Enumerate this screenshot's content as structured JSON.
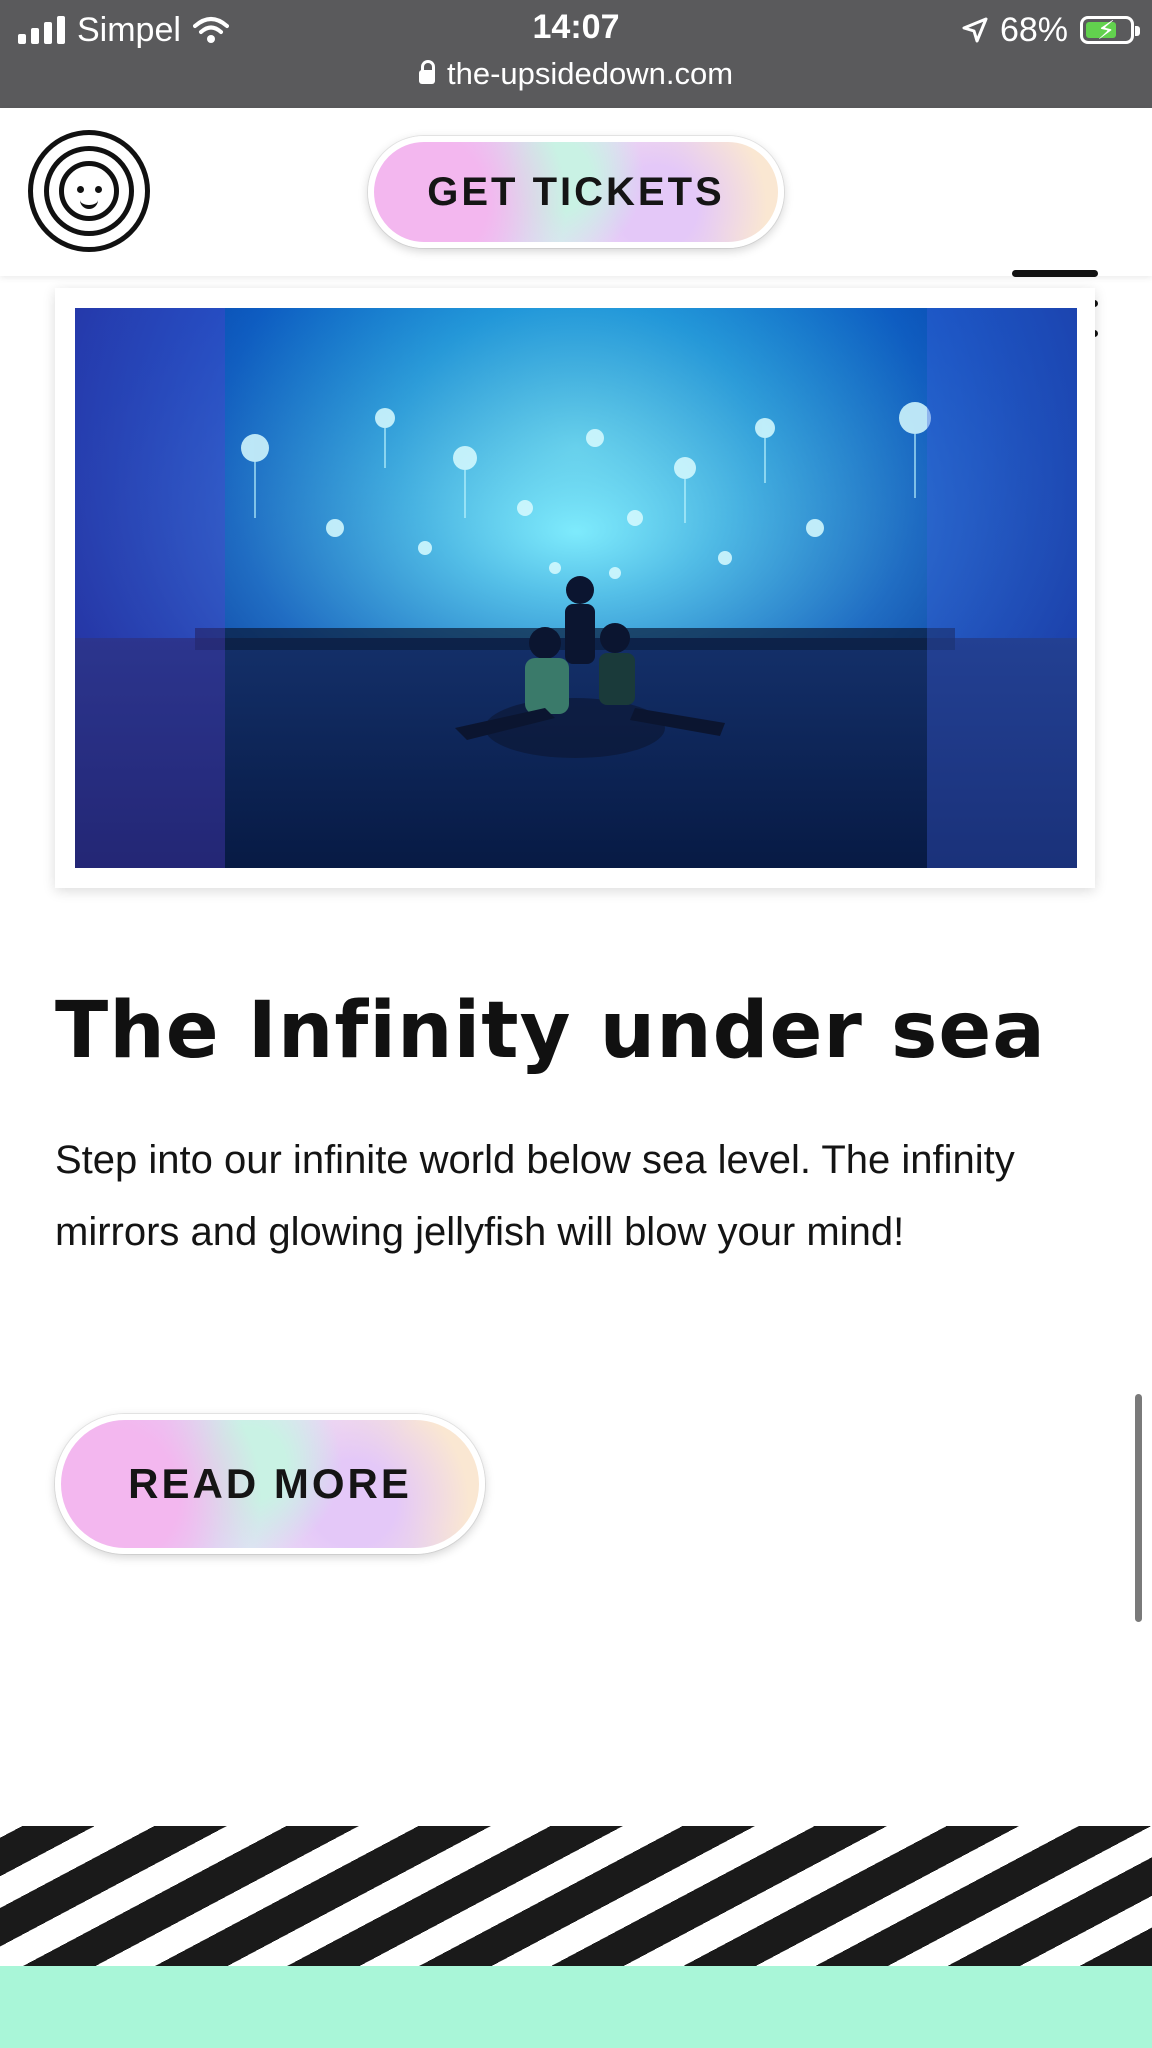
{
  "status_bar": {
    "carrier": "Simpel",
    "time": "14:07",
    "battery": "68%",
    "battery_level": 0.68,
    "url": "the-upsidedown.com"
  },
  "header": {
    "logo_icon": "smiley-rings-logo",
    "tickets_label": "GET TICKETS",
    "menu_icon": "hamburger-menu-icon"
  },
  "article": {
    "image_alt": "Infinity mirror room with glowing jellyfish",
    "title": "The Infinity under sea",
    "description": "Step into our infinite world below sea level. The infinity mirrors and glowing jellyfish will blow your mind!",
    "read_more_label": "READ MORE"
  },
  "colors": {
    "statusbar_bg": "#5a5a5c",
    "footer_mint": "#a9f6d8",
    "stripe_dark": "#1a1a1a",
    "battery_green": "#62d14e"
  }
}
